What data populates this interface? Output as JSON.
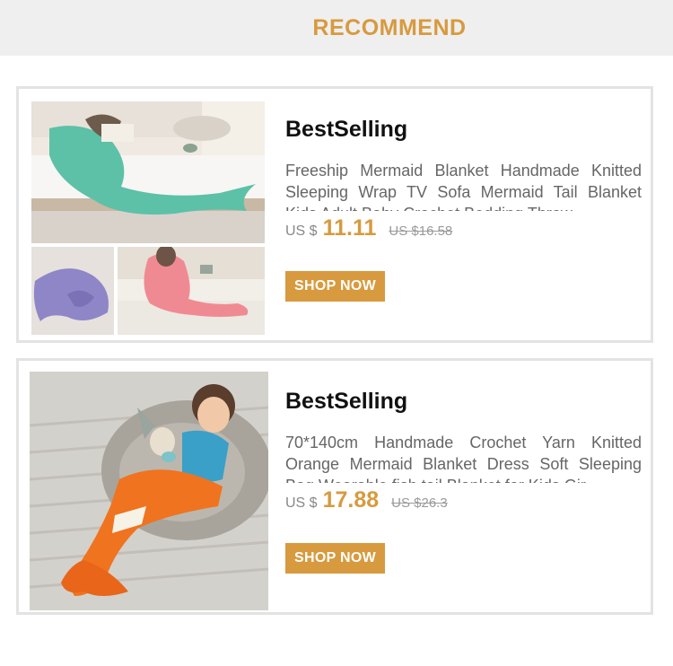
{
  "header": {
    "title": "RECOMMEND"
  },
  "products": [
    {
      "badge": "BestSelling",
      "title": "Freeship Mermaid Blanket Handmade Knitted Sleeping Wrap TV Sofa Mermaid Tail Blanket Kids Adult Baby Crochet Bedding Throw",
      "currency": "US $",
      "price": "11.11",
      "old_price": "US $16.58",
      "cta": "SHOP NOW"
    },
    {
      "badge": "BestSelling",
      "title": "70*140cm Handmade Crochet Yarn Knitted Orange Mermaid Blanket Dress Soft Sleeping Bag Wearable fish tail Blanket for Kids Gir",
      "currency": "US $",
      "price": "17.88",
      "old_price": "US $26.3",
      "cta": "SHOP NOW"
    }
  ],
  "colors": {
    "accent": "#d79a3e",
    "header_bg": "#efefef",
    "border": "#e3e3e3"
  }
}
